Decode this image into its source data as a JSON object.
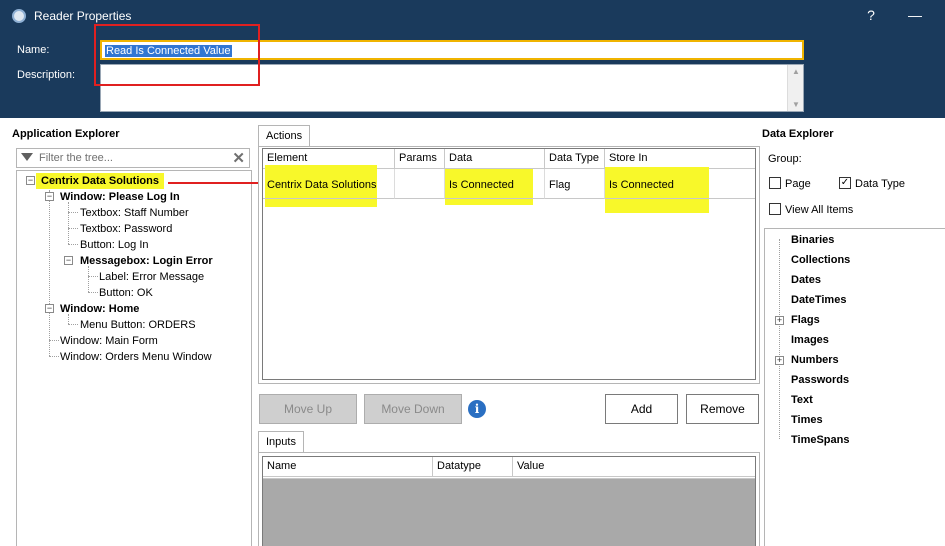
{
  "window": {
    "title": "Reader Properties",
    "help": "?",
    "minimize": "—"
  },
  "header": {
    "name_label": "Name:",
    "name_value": "Read Is Connected Value",
    "description_label": "Description:",
    "description_value": ""
  },
  "app_explorer": {
    "title": "Application Explorer",
    "filter_placeholder": "Filter the tree...",
    "nodes": [
      "Centrix Data Solutions",
      "Window: Please Log In",
      "Textbox: Staff Number",
      "Textbox: Password",
      "Button: Log In",
      "Messagebox: Login Error",
      "Label: Error Message",
      "Button: OK",
      "Window: Home",
      "Menu Button: ORDERS",
      "Window: Main Form",
      "Window: Orders Menu Window"
    ]
  },
  "actions": {
    "tab_label": "Actions",
    "columns": [
      "Element",
      "Params",
      "Data",
      "Data Type",
      "Store In"
    ],
    "row": {
      "element": "Centrix Data Solutions",
      "params": "",
      "data": "Is Connected",
      "data_type": "Flag",
      "store_in": "Is Connected"
    },
    "buttons": {
      "move_up": "Move Up",
      "move_down": "Move Down",
      "add": "Add",
      "remove": "Remove"
    },
    "info_glyph": "i"
  },
  "inputs": {
    "tab_label": "Inputs",
    "columns": [
      "Name",
      "Datatype",
      "Value"
    ]
  },
  "data_explorer": {
    "title": "Data Explorer",
    "group_label": "Group:",
    "page_label": "Page",
    "page_checked": false,
    "data_type_label": "Data Type",
    "data_type_checked": true,
    "view_all_label": "View All Items",
    "view_all_checked": false,
    "items": [
      "Binaries",
      "Collections",
      "Dates",
      "DateTimes",
      "Flags",
      "Images",
      "Numbers",
      "Passwords",
      "Text",
      "Times",
      "TimeSpans"
    ]
  },
  "colors": {
    "titlebar": "#1a3a5c",
    "highlight": "#f8f82a",
    "annotation": "#e02020",
    "selection": "#3176d2"
  }
}
